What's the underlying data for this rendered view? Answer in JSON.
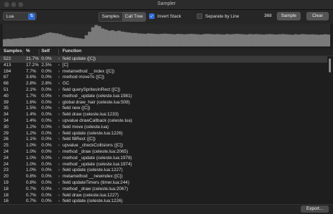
{
  "window": {
    "title": "Sampler"
  },
  "toolbar": {
    "language_select": "Lua",
    "view_tabs": [
      {
        "label": "Samples",
        "active": false
      },
      {
        "label": "Call Tree",
        "active": true
      }
    ],
    "invert_stack": {
      "label": "Invert Stack",
      "checked": true
    },
    "separate_by_line": {
      "label": "Separate by Line",
      "checked": false
    },
    "sample_count": "368",
    "sample_button": "Sample",
    "clear_button": "Clear"
  },
  "timeline_graph": {
    "heights": [
      0.32,
      0.34,
      0.33,
      0.35,
      0.36,
      0.38,
      0.37,
      0.39,
      0.4,
      0.42,
      0.45,
      0.5,
      0.55,
      0.6,
      0.62,
      0.6,
      0.58,
      0.55,
      0.5,
      0.45,
      0.42,
      0.4,
      0.38,
      0.36,
      0.34,
      0.5,
      0.65,
      0.85,
      0.95,
      0.9,
      0.8,
      0.75,
      0.7,
      0.72,
      0.68,
      0.7,
      0.66,
      0.64,
      0.62,
      0.6,
      0.6,
      0.58,
      0.57,
      0.56,
      0.58,
      0.57,
      0.56,
      0.55,
      0.56,
      0.57,
      0.56,
      0.55,
      0.54,
      0.56,
      0.55,
      0.54,
      0.55,
      0.56,
      0.55,
      0.54,
      0.53,
      0.55,
      0.56,
      0.55,
      0.54,
      0.55,
      0.54,
      0.53,
      0.55,
      0.54,
      0.55,
      0.56,
      0.55,
      0.54,
      0.53,
      0.55,
      0.54,
      0.55,
      0.54,
      0.53,
      0.54,
      0.55,
      0.54,
      0.53,
      0.54,
      0.55,
      0.54,
      0.53,
      0.52,
      0.54,
      0.53,
      0.55,
      0.54,
      0.53,
      0.54,
      0.53,
      0.52,
      0.53,
      0.54,
      0.53
    ],
    "bar_color": "#7a7a7a"
  },
  "table": {
    "headers": [
      "Samples",
      "%",
      "Self",
      "Function"
    ],
    "rows": [
      {
        "samples": "522",
        "pct": "21.7%",
        "self": "0.0%",
        "func": "field update ([C])",
        "selected": true
      },
      {
        "samples": "413",
        "pct": "17.2%",
        "self": "2.5%",
        "func": "[C]"
      },
      {
        "samples": "184",
        "pct": "7.7%",
        "self": "0.0%",
        "func": "metamethod __index ([C])"
      },
      {
        "samples": "87",
        "pct": "3.6%",
        "self": "0.0%",
        "func": "method moveTo ([C])"
      },
      {
        "samples": "68",
        "pct": "2.8%",
        "self": "2.8%",
        "func": "GC"
      },
      {
        "samples": "51",
        "pct": "2.1%",
        "self": "0.0%",
        "func": "field querySpritesInRect ([C])"
      },
      {
        "samples": "40",
        "pct": "1.7%",
        "self": "0.0%",
        "func": "method _update (celeste.lua:1981)"
      },
      {
        "samples": "39",
        "pct": "1.6%",
        "self": "0.0%",
        "func": "global draw_hair (celeste.lua:508)"
      },
      {
        "samples": "35",
        "pct": "1.5%",
        "self": "0.0%",
        "func": "field new ([C])"
      },
      {
        "samples": "34",
        "pct": "1.4%",
        "self": "0.0%",
        "func": "field draw (celeste.lua:1233)"
      },
      {
        "samples": "34",
        "pct": "1.4%",
        "self": "0.0%",
        "func": "upvalue drawCallback (celeste.lua)"
      },
      {
        "samples": "30",
        "pct": "1.2%",
        "self": "0.0%",
        "func": "field move (celeste.lua)"
      },
      {
        "samples": "29",
        "pct": "1.2%",
        "self": "0.0%",
        "func": "field update (celeste.lua:1226)"
      },
      {
        "samples": "26",
        "pct": "1.1%",
        "self": "0.0%",
        "func": "field fillRect ([C])"
      },
      {
        "samples": "25",
        "pct": "1.0%",
        "self": "0.0%",
        "func": "upvalue _checkCollisions ([C])"
      },
      {
        "samples": "24",
        "pct": "1.0%",
        "self": "0.0%",
        "func": "method _draw (celeste.lua:2065)"
      },
      {
        "samples": "24",
        "pct": "1.0%",
        "self": "0.0%",
        "func": "method _update (celeste.lua:1978)"
      },
      {
        "samples": "24",
        "pct": "1.0%",
        "self": "0.0%",
        "func": "method _update (celeste.lua:1974)"
      },
      {
        "samples": "23",
        "pct": "1.0%",
        "self": "0.0%",
        "func": "field update (celeste.lua:1227)"
      },
      {
        "samples": "20",
        "pct": "0.8%",
        "self": "0.0%",
        "func": "metamethod __newindex ([C])"
      },
      {
        "samples": "19",
        "pct": "0.8%",
        "self": "0.0%",
        "func": "field updateTimers (timer.lua:244)"
      },
      {
        "samples": "18",
        "pct": "0.7%",
        "self": "0.0%",
        "func": "method _draw (celeste.lua:2067)"
      },
      {
        "samples": "18",
        "pct": "0.7%",
        "self": "0.0%",
        "func": "field draw (celeste.lua:1227)"
      },
      {
        "samples": "16",
        "pct": "0.7%",
        "self": "0.0%",
        "func": "field update (celeste.lua:1226)"
      }
    ]
  },
  "footer": {
    "export_button": "Export..."
  },
  "colors": {
    "accent": "#2f6bd8",
    "background": "#1e1e1e"
  }
}
